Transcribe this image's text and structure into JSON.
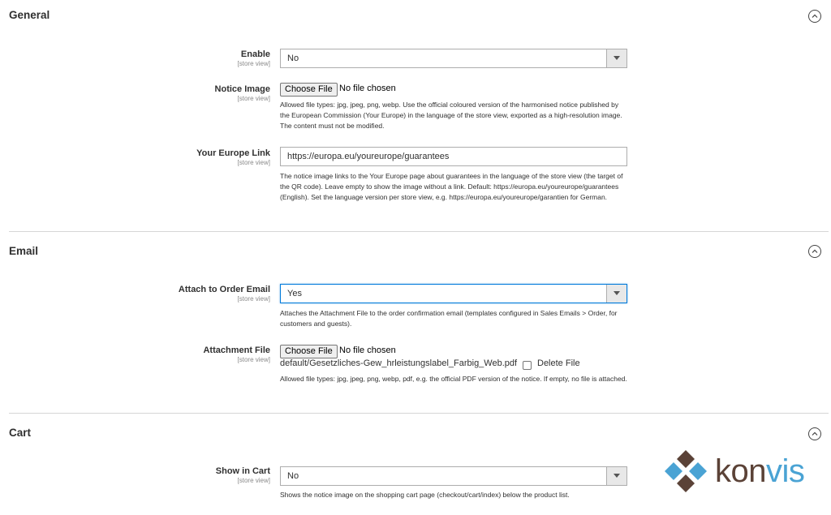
{
  "sections": {
    "general": {
      "title": "General",
      "enable": {
        "label": "Enable",
        "scope": "[store view]",
        "value": "No"
      },
      "notice_image": {
        "label": "Notice Image",
        "scope": "[store view]",
        "button": "Choose File",
        "status": "No file chosen",
        "note": "Allowed file types: jpg, jpeg, png, webp. Use the official coloured version of the harmonised notice published by the European Commission (Your Europe) in the language of the store view, exported as a high-resolution image. The content must not be modified."
      },
      "europe_link": {
        "label": "Your Europe Link",
        "scope": "[store view]",
        "value": "https://europa.eu/youreurope/guarantees",
        "note": "The notice image links to the Your Europe page about guarantees in the language of the store view (the target of the QR code). Leave empty to show the image without a link. Default: https://europa.eu/youreurope/guarantees (English). Set the language version per store view, e.g. https://europa.eu/youreurope/garantien for German."
      }
    },
    "email": {
      "title": "Email",
      "attach": {
        "label": "Attach to Order Email",
        "scope": "[store view]",
        "value": "Yes",
        "note": "Attaches the Attachment File to the order confirmation email (templates configured in Sales Emails > Order, for customers and guests)."
      },
      "attachment_file": {
        "label": "Attachment File",
        "scope": "[store view]",
        "button": "Choose File",
        "status": "No file chosen",
        "current_file": "default/Gesetzliches-Gew_hrleistungslabel_Farbig_Web.pdf",
        "delete_label": "Delete File",
        "note": "Allowed file types: jpg, jpeg, png, webp, pdf, e.g. the official PDF version of the notice. If empty, no file is attached."
      }
    },
    "cart": {
      "title": "Cart",
      "show_in_cart": {
        "label": "Show in Cart",
        "scope": "[store view]",
        "value": "No",
        "note": "Shows the notice image on the shopping cart page (checkout/cart/index) below the product list."
      }
    }
  },
  "logo": {
    "wordmark": "konvis",
    "wordmark_color": "#5b4237",
    "diamond_blue": "#4aa3d4",
    "diamond_brown": "#5b4237"
  },
  "colors": {
    "focus_border": "#007bdb",
    "text": "#303030",
    "muted": "#8a8a8a"
  }
}
